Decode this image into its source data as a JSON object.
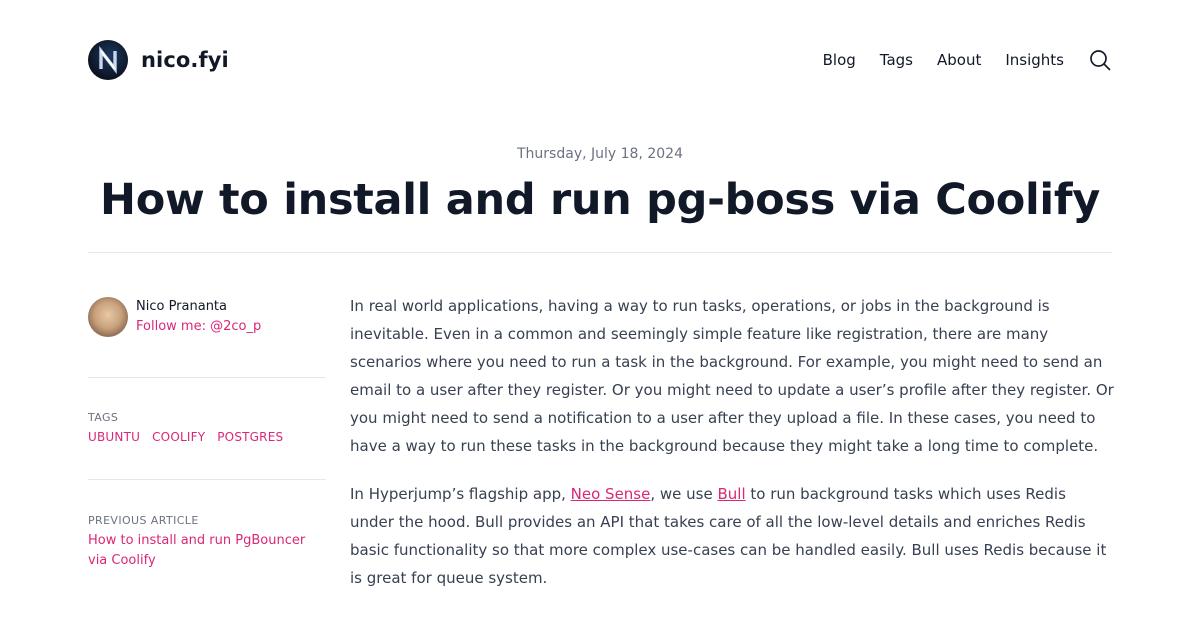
{
  "header": {
    "site_name": "nico.fyi",
    "nav": [
      "Blog",
      "Tags",
      "About",
      "Insights"
    ]
  },
  "post": {
    "date": "Thursday, July 18, 2024",
    "title": "How to install and run pg-boss via Coolify"
  },
  "sidebar": {
    "author_name": "Nico Prananta",
    "follow_text": "Follow me: @2co_p",
    "tags_label": "TAGS",
    "tags": [
      "UBUNTU",
      "COOLIFY",
      "POSTGRES"
    ],
    "previous_label": "PREVIOUS ARTICLE",
    "previous_title": "How to install and run PgBouncer via Coolify"
  },
  "article": {
    "p1": "In real world applications, having a way to run tasks, operations, or jobs in the background is inevitable. Even in a common and seemingly simple feature like registration, there are many scenarios where you need to run a task in the background. For example, you might need to send an email to a user after they register. Or you might need to update a user’s profile after they register. Or you might need to send a notification to a user after they upload a file. In these cases, you need to have a way to run these tasks in the background because they might take a long time to complete.",
    "p2_before": "In Hyperjump’s flagship app, ",
    "p2_link1": "Neo Sense",
    "p2_middle": ", we use ",
    "p2_link2": "Bull",
    "p2_after": " to run background tasks which uses Redis under the hood. Bull provides an API that takes care of all the low-level details and enriches Redis basic functionality so that more complex use-cases can be handled easily. Bull uses Redis because it is great for queue system."
  },
  "icons": {
    "logo": "nico-logo-icon",
    "search": "search-icon",
    "avatar": "avatar"
  },
  "colors": {
    "accent": "#db2777",
    "text": "#111827",
    "body_text": "#374151",
    "muted": "#6b7280",
    "divider": "#e5e7eb"
  }
}
